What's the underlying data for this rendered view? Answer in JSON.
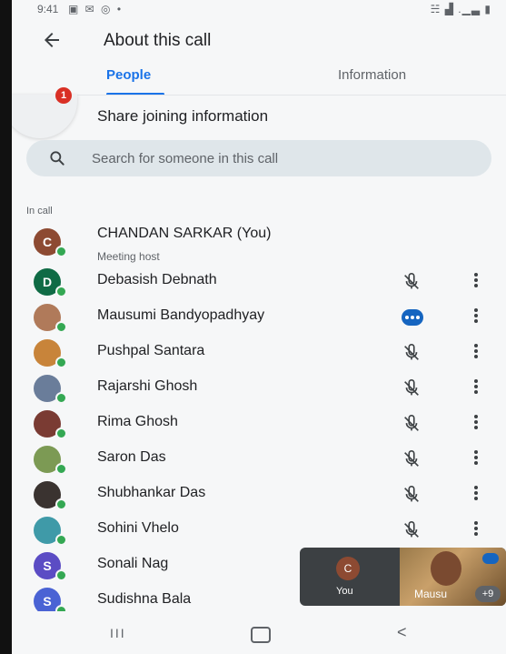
{
  "status_bar": {
    "time": "9:41",
    "left_icons": "▣ ✉ ◎ •",
    "right_icons": "☵ ▟ .▁▃ ▮"
  },
  "header": {
    "title": "About this call",
    "back_icon": "arrow-back-icon"
  },
  "tabs": [
    {
      "label": "People",
      "active": true
    },
    {
      "label": "Information",
      "active": false
    }
  ],
  "share": {
    "label": "Share joining information",
    "badge": "1"
  },
  "search": {
    "placeholder": "Search for someone in this call"
  },
  "section_label": "In call",
  "participants": [
    {
      "name": "CHANDAN SARKAR (You)",
      "sub": "Meeting host",
      "initial": "C",
      "color": "#8d4a32",
      "status": "none"
    },
    {
      "name": "Debasish Debnath",
      "initial": "D",
      "color": "#0f6b45",
      "status": "muted"
    },
    {
      "name": "Mausumi Bandyopadhyay",
      "initial": "",
      "color": "#b07a5a",
      "status": "speaking"
    },
    {
      "name": "Pushpal Santara",
      "initial": "",
      "color": "#c8843a",
      "status": "muted"
    },
    {
      "name": "Rajarshi Ghosh",
      "initial": "",
      "color": "#6a7d9a",
      "status": "muted"
    },
    {
      "name": "Rima Ghosh",
      "initial": "",
      "color": "#7a3b33",
      "status": "muted"
    },
    {
      "name": "Saron Das",
      "initial": "",
      "color": "#7c9a54",
      "status": "muted"
    },
    {
      "name": "Shubhankar Das",
      "initial": "",
      "color": "#3a3330",
      "status": "muted"
    },
    {
      "name": "Sohini Vhelo",
      "initial": "",
      "color": "#3f9aa8",
      "status": "muted"
    },
    {
      "name": "Sonali Nag",
      "initial": "S",
      "color": "#5b4cc4",
      "status": "none"
    },
    {
      "name": "Sudishna Bala",
      "initial": "S",
      "color": "#4a63d4",
      "status": "none"
    }
  ],
  "floating_tile": {
    "you_initial": "C",
    "you_label": "You",
    "other_label": "Mausu",
    "more_count": "+9"
  },
  "nav": {
    "recents": "III",
    "back": "<"
  }
}
